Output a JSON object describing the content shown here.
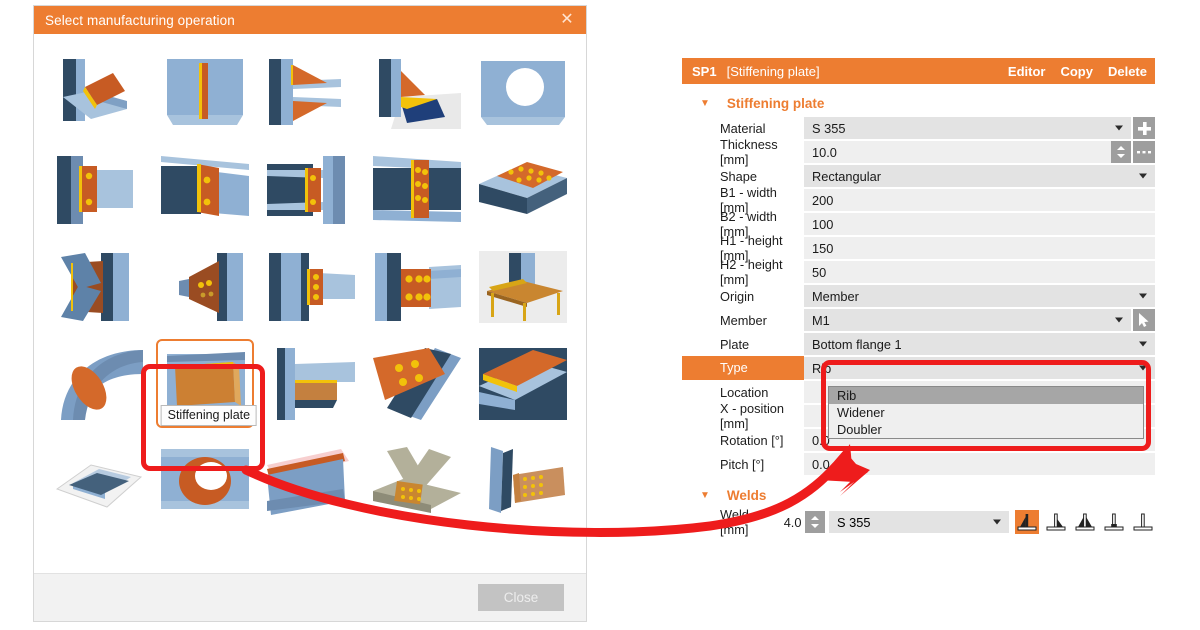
{
  "dialog": {
    "title": "Select manufacturing operation",
    "close_icon": "close-icon",
    "footer_button": "Close",
    "selected_item_tooltip": "Stiffening plate",
    "items": [
      {
        "id": "cut-beam-to-beam"
      },
      {
        "id": "stiffener-web"
      },
      {
        "id": "haunch-plate"
      },
      {
        "id": "base-plate-anchor"
      },
      {
        "id": "opening-circular"
      },
      {
        "id": "fin-plate"
      },
      {
        "id": "end-plate-beam"
      },
      {
        "id": "angle-cleat-web"
      },
      {
        "id": "bolted-splice-plate"
      },
      {
        "id": "bolted-cover-plate"
      },
      {
        "id": "gusset-plate-braces"
      },
      {
        "id": "cone-hollow-section"
      },
      {
        "id": "shear-tab-bolts"
      },
      {
        "id": "bolted-end-plate-grid"
      },
      {
        "id": "base-plate-stool"
      },
      {
        "id": "bent-hollow-section"
      },
      {
        "id": "stiffening-plate"
      },
      {
        "id": "notched-beam"
      },
      {
        "id": "splice-lap-plate"
      },
      {
        "id": "cover-plate-flange"
      },
      {
        "id": "concrete-block-footing"
      },
      {
        "id": "opening-hollow-section"
      },
      {
        "id": "cold-formed-section"
      },
      {
        "id": "timber-bolted-joint"
      },
      {
        "id": "bolted-bracket"
      }
    ]
  },
  "panel": {
    "header": {
      "id": "SP1",
      "name": "[Stiffening plate]",
      "editor": "Editor",
      "copy": "Copy",
      "delete": "Delete"
    },
    "section_plate": {
      "title": "Stiffening plate",
      "rows": [
        {
          "label": "Material",
          "value": "S 355"
        },
        {
          "label": "Thickness [mm]",
          "value": "10.0"
        },
        {
          "label": "Shape",
          "value": "Rectangular"
        },
        {
          "label": "B1 - width [mm]",
          "value": "200"
        },
        {
          "label": "B2 - width [mm]",
          "value": "100"
        },
        {
          "label": "H1 - height [mm]",
          "value": "150"
        },
        {
          "label": "H2 - height [mm]",
          "value": "50"
        },
        {
          "label": "Origin",
          "value": "Member"
        },
        {
          "label": "Member",
          "value": "M1"
        },
        {
          "label": "Plate",
          "value": "Bottom flange 1"
        },
        {
          "label": "Type",
          "value": "Rib"
        },
        {
          "label": "Location",
          "value": ""
        },
        {
          "label": "X - position [mm]",
          "value": ""
        },
        {
          "label": "Rotation [°]",
          "value": "0.0"
        },
        {
          "label": "Pitch [°]",
          "value": "0.0"
        }
      ]
    },
    "type_dropdown": {
      "options": [
        "Rib",
        "Widener",
        "Doubler"
      ],
      "selected": "Rib"
    },
    "section_welds": {
      "title": "Welds",
      "row_label": "Weld [mm]",
      "size": "4.0",
      "material": "S 355",
      "weld_icons": [
        {
          "name": "fillet-weld-icon",
          "selected": true
        },
        {
          "name": "single-bevel-weld-icon",
          "selected": false
        },
        {
          "name": "double-bevel-weld-icon",
          "selected": false
        },
        {
          "name": "partial-penetration-weld-icon",
          "selected": false
        },
        {
          "name": "butt-weld-icon",
          "selected": false
        }
      ]
    }
  },
  "colors": {
    "accent": "#ed7d31",
    "annotation": "#ee1c1c",
    "field": "#efefef",
    "combo": "#e3e3e3",
    "dropdown_highlight": "#a6a6a6"
  }
}
